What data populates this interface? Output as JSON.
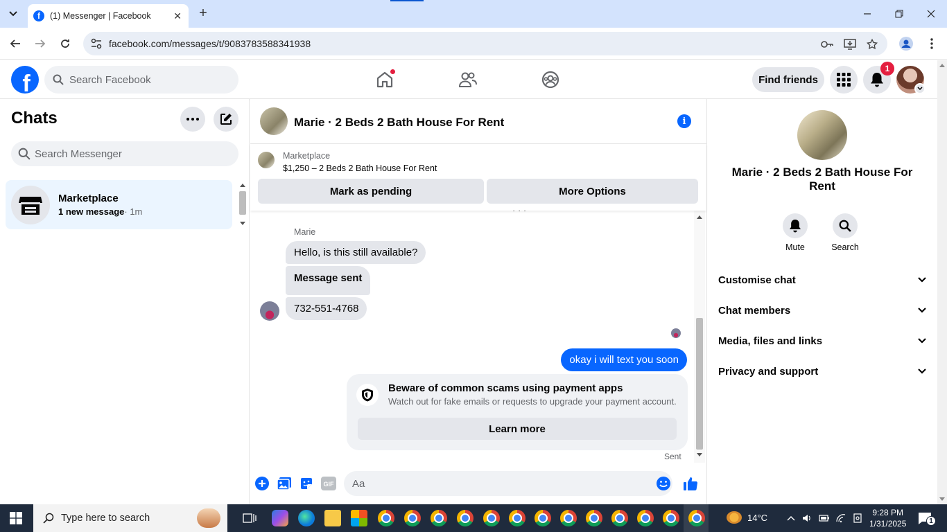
{
  "browser": {
    "tab_title": "(1) Messenger | Facebook",
    "url": "facebook.com/messages/t/9083783588341938"
  },
  "header": {
    "search_placeholder": "Search Facebook",
    "find_friends": "Find friends",
    "notification_count": "1"
  },
  "chats": {
    "title": "Chats",
    "search_placeholder": "Search Messenger",
    "items": [
      {
        "name": "Marketplace",
        "preview": "1 new message",
        "time": "· 1m"
      }
    ]
  },
  "conversation": {
    "title": "Marie · 2 Beds 2 Bath House For Rent",
    "marketplace_label": "Marketplace",
    "listing": "$1,250 – 2 Beds 2 Bath House For Rent",
    "mark_pending": "Mark as pending",
    "more_options": "More Options",
    "sender": "Marie",
    "messages_in": [
      "Hello, is this still available?",
      "Message sent",
      "732-551-4768"
    ],
    "message_out": "okay i will text you soon",
    "scam_title": "Beware of common scams using payment apps",
    "scam_sub": "Watch out for fake emails or requests to upgrade your payment account.",
    "learn_more": "Learn more",
    "status": "Sent",
    "composer_placeholder": "Aa"
  },
  "right_panel": {
    "name": "Marie · 2 Beds 2 Bath House For Rent",
    "mute": "Mute",
    "search": "Search",
    "rows": [
      "Customise chat",
      "Chat members",
      "Media, files and links",
      "Privacy and support"
    ]
  },
  "taskbar": {
    "search_placeholder": "Type here to search",
    "temperature": "14°C",
    "time": "9:28 PM",
    "date": "1/31/2025",
    "notif_count": "1"
  },
  "colors": {
    "fb_blue": "#0866ff",
    "badge_red": "#e41e3f",
    "chip_grey": "#e4e6eb",
    "selected_chat": "#ebf5ff"
  }
}
